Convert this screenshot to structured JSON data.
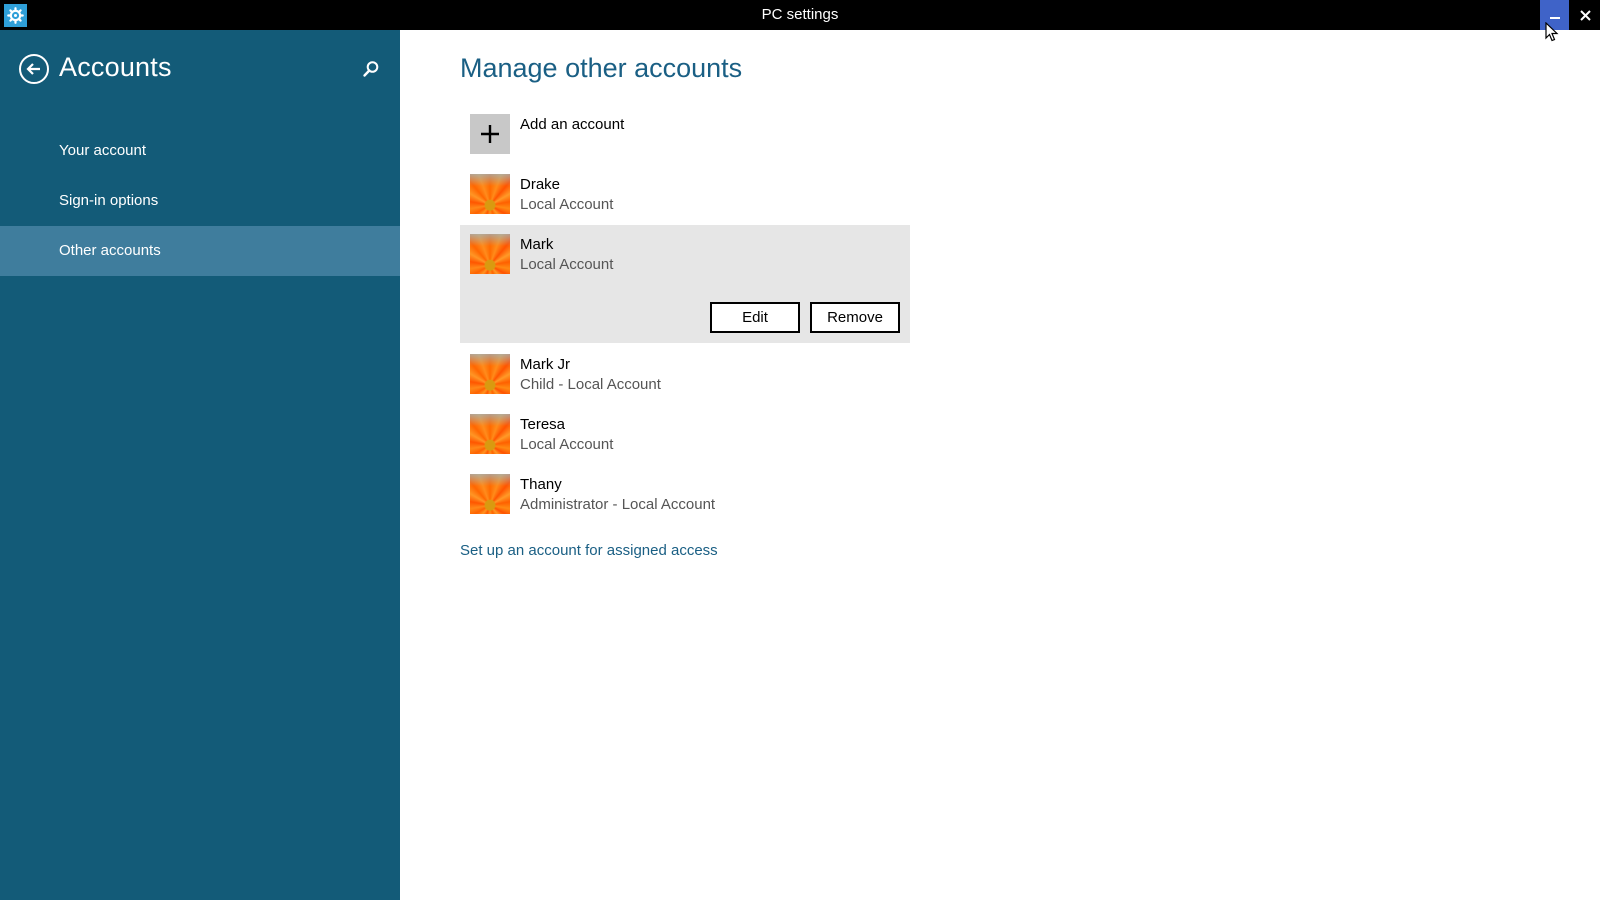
{
  "window": {
    "title": "PC settings",
    "icon": "gear-icon",
    "accent_color": "#3f63c8"
  },
  "sidebar": {
    "title": "Accounts",
    "background": "#135b78",
    "items": [
      {
        "label": "Your account",
        "selected": false
      },
      {
        "label": "Sign-in options",
        "selected": false
      },
      {
        "label": "Other accounts",
        "selected": true
      }
    ]
  },
  "main": {
    "title": "Manage other accounts",
    "add_account_label": "Add an account",
    "accounts": [
      {
        "name": "Drake",
        "type": "Local Account"
      },
      {
        "name": "Mark",
        "type": "Local Account",
        "selected": true
      },
      {
        "name": "Mark Jr",
        "type": "Child - Local Account"
      },
      {
        "name": "Teresa",
        "type": "Local Account"
      },
      {
        "name": "Thany",
        "type": "Administrator - Local Account"
      }
    ],
    "edit_label": "Edit",
    "remove_label": "Remove",
    "assigned_access_link": "Set up an account for assigned access"
  }
}
